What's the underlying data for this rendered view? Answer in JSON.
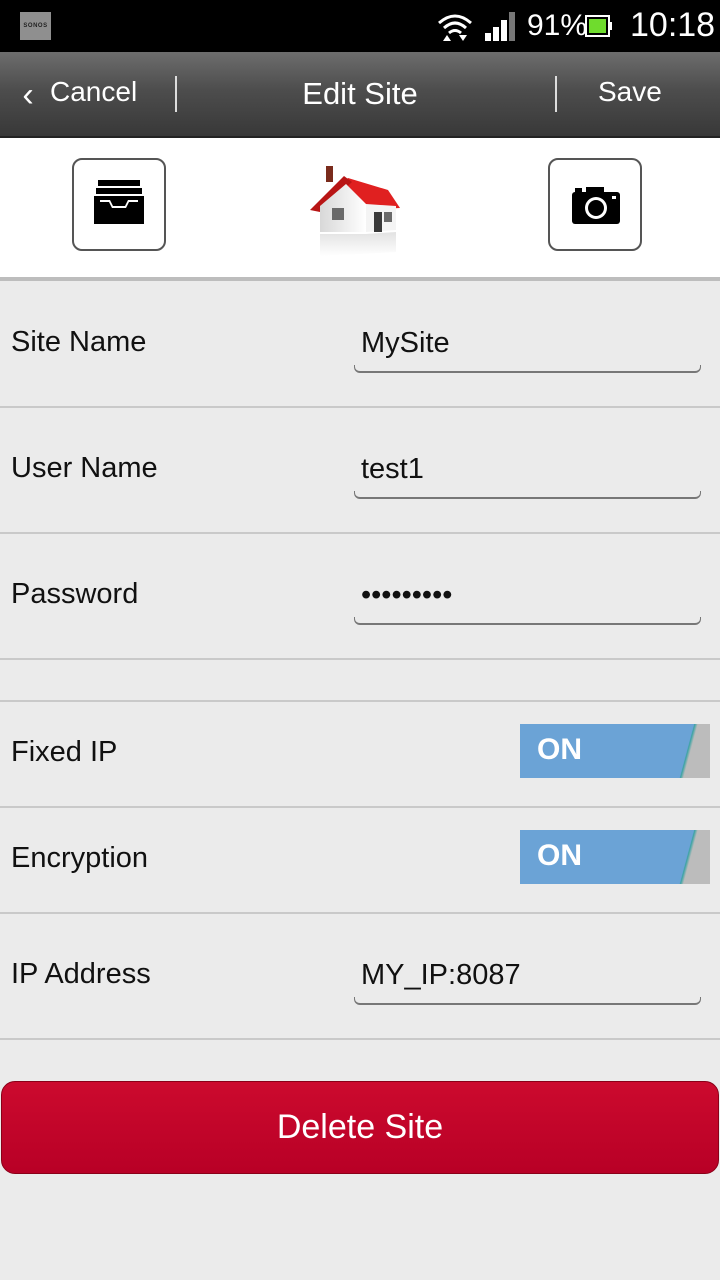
{
  "status_bar": {
    "app_badge": "SONOS",
    "battery_percent": "91%",
    "time": "10:18",
    "icons": [
      "wifi-icon",
      "signal-icon",
      "battery-icon"
    ]
  },
  "action_bar": {
    "back_glyph": "‹",
    "cancel_label": "Cancel",
    "title": "Edit Site",
    "save_label": "Save"
  },
  "icon_row": {
    "left_icon": "archive-tray-icon",
    "center_image": "house-icon",
    "right_icon": "camera-icon"
  },
  "form": {
    "site_name": {
      "label": "Site Name",
      "value": "MySite"
    },
    "user_name": {
      "label": "User Name",
      "value": "test1"
    },
    "password": {
      "label": "Password",
      "value": "•••••••••"
    },
    "fixed_ip": {
      "label": "Fixed IP",
      "state": "ON"
    },
    "encryption": {
      "label": "Encryption",
      "state": "ON"
    },
    "ip_address": {
      "label": "IP Address",
      "value": "MY_IP:8087"
    }
  },
  "delete_button": {
    "label": "Delete Site"
  },
  "colors": {
    "toggle_on": "#6ba3d6",
    "delete": "#c20029",
    "action_bar": "#4d4d4d"
  }
}
